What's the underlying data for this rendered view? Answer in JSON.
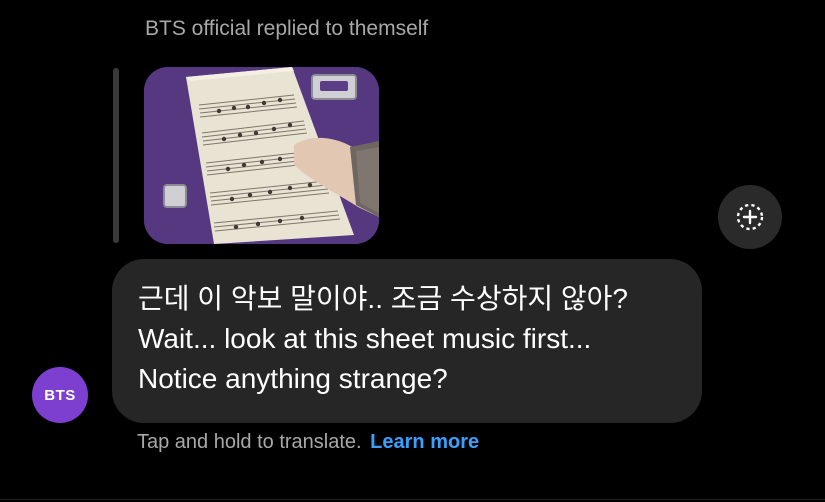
{
  "reply_label": "BTS official replied to themself",
  "message": {
    "line1": "근데 이 악보 말이야.. 조금 수상하지 않아?",
    "line2": "Wait... look at this sheet music first...",
    "line3": "Notice anything strange?"
  },
  "avatar_text": "BTS",
  "translate": {
    "hint": "Tap and hold to translate.",
    "link": "Learn more"
  },
  "colors": {
    "background": "#000000",
    "bubble": "#262626",
    "avatar": "#7d3fd0",
    "link": "#3aa0ff",
    "muted_text": "#a8a8a8"
  },
  "icons": {
    "react": "add-reaction-icon"
  }
}
